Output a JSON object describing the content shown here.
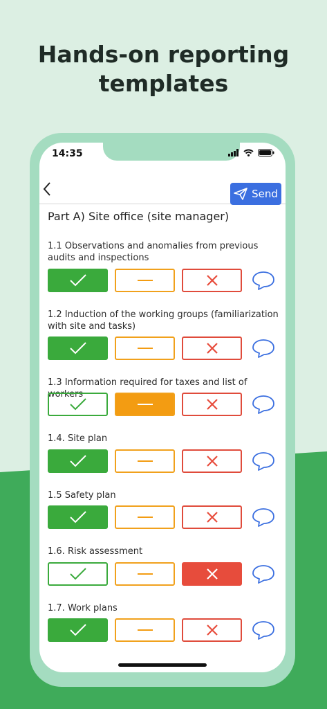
{
  "headline": "Hands-on reporting\ntemplates",
  "status": {
    "time": "14:35"
  },
  "nav": {
    "send_label": "Send"
  },
  "part_title": "Part A) Site office (site manager)",
  "colors": {
    "green": "#3aaa3c",
    "orange": "#f39c12",
    "red": "#e74c3c",
    "blue": "#3b6fe0"
  },
  "items": [
    {
      "label": "1.1 Observations and anomalies from previous audits and inspections",
      "selected": "yes"
    },
    {
      "label": "1.2 Induction of the working groups (familiarization with site and tasks)",
      "selected": "yes"
    },
    {
      "label": "1.3 Information required for taxes and list of workers",
      "selected": "mid"
    },
    {
      "label": "1.4. Site plan",
      "selected": "yes"
    },
    {
      "label": "1.5 Safety plan",
      "selected": "yes"
    },
    {
      "label": "1.6. Risk assessment",
      "selected": "no"
    },
    {
      "label": "1.7. Work plans",
      "selected": "yes"
    }
  ]
}
